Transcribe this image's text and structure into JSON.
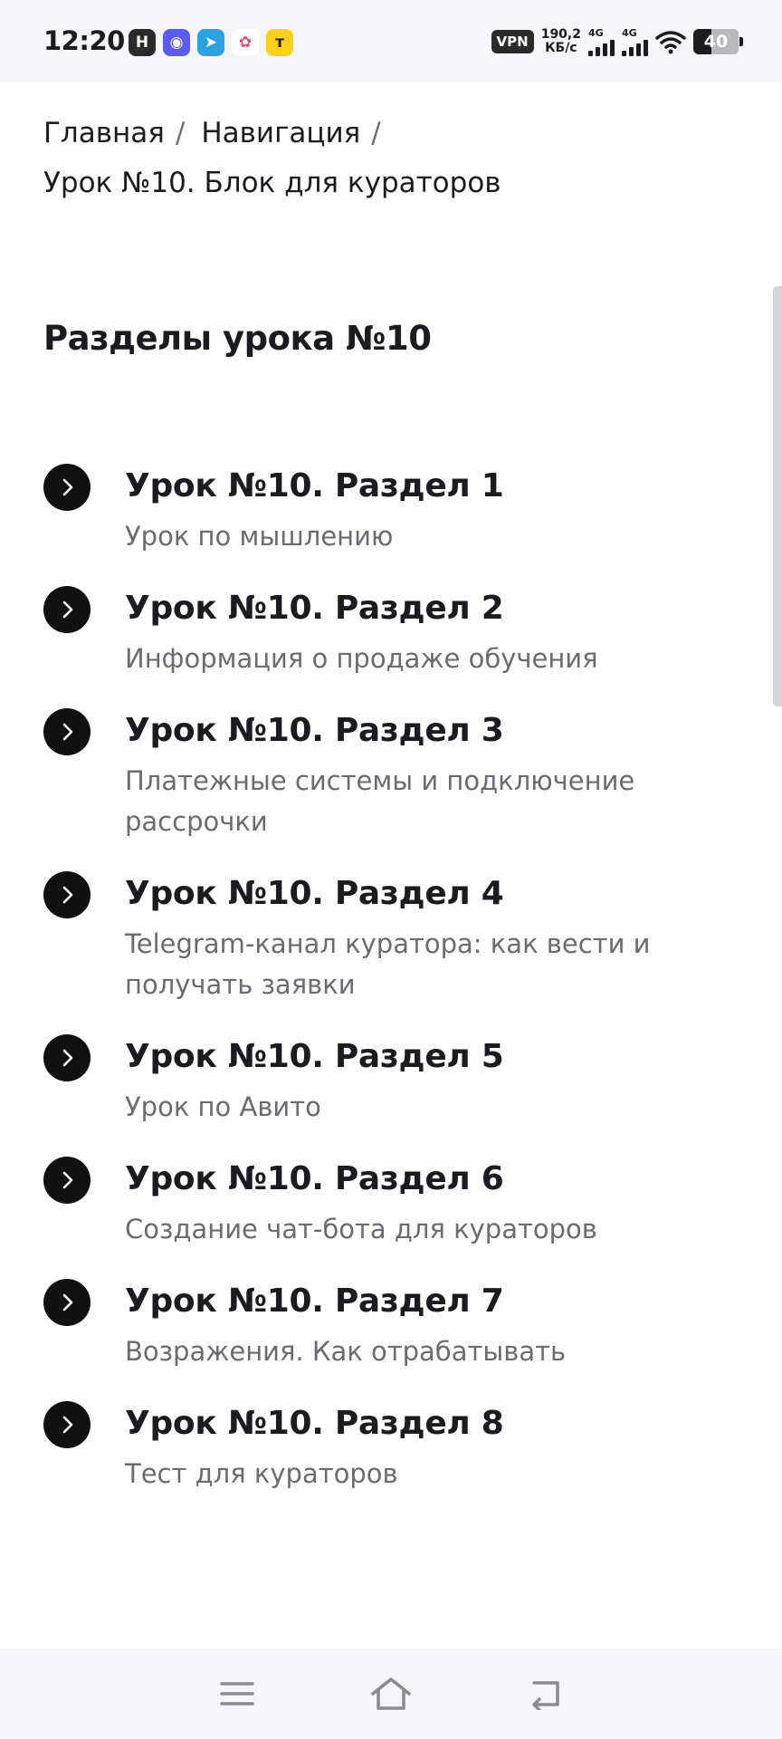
{
  "status_bar": {
    "time": "12:20",
    "apps": [
      {
        "icon": "h-app-icon",
        "glyph": "H",
        "color": "#2b2b2b"
      },
      {
        "icon": "messenger-icon",
        "glyph": "◉",
        "color": "#5b5bf0"
      },
      {
        "icon": "telegram-icon",
        "glyph": "➤",
        "color": "#2aa3e0"
      },
      {
        "icon": "dots-app-icon",
        "glyph": "✿",
        "color": "#ffffff"
      },
      {
        "icon": "yellow-app-icon",
        "glyph": "т",
        "color": "#ffd11a"
      }
    ],
    "vpn": "VPN",
    "speed_value": "190,2",
    "speed_unit": "КБ/с",
    "net1": "4G",
    "net2": "4G",
    "battery": "40",
    "battery_level": 0.4
  },
  "breadcrumb": {
    "home": "Главная",
    "nav": "Навигация",
    "separator": "/",
    "current": "Урок №10. Блок для кураторов"
  },
  "section": {
    "title": "Разделы урока №10"
  },
  "items": [
    {
      "title": "Урок №10. Раздел 1",
      "subtitle": "Урок по мышлению"
    },
    {
      "title": "Урок №10. Раздел 2",
      "subtitle": "Информация о продаже обучения"
    },
    {
      "title": "Урок №10. Раздел 3",
      "subtitle": "Платежные системы и подключение рассрочки"
    },
    {
      "title": "Урок №10. Раздел 4",
      "subtitle": "Telegram-канал куратора: как вести и получать заявки"
    },
    {
      "title": "Урок №10. Раздел 5",
      "subtitle": "Урок по Авито"
    },
    {
      "title": "Урок №10. Раздел 6",
      "subtitle": "Создание чат-бота для кураторов"
    },
    {
      "title": "Урок №10. Раздел 7",
      "subtitle": "Возражения. Как отрабатывать"
    },
    {
      "title": "Урок №10. Раздел 8",
      "subtitle": "Тест для кураторов"
    }
  ],
  "nav_bar": {
    "icons": [
      "menu-icon",
      "home-icon",
      "back-icon"
    ]
  }
}
